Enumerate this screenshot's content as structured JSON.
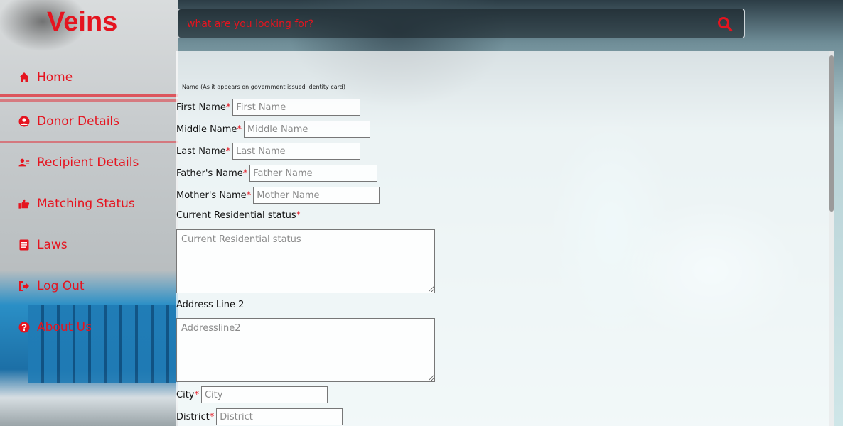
{
  "brand": "Veins",
  "nav": [
    {
      "label": "Home",
      "icon": "home-icon"
    },
    {
      "label": "Donor Details",
      "icon": "user-circle-icon"
    },
    {
      "label": "Recipient Details",
      "icon": "users-icon"
    },
    {
      "label": "Matching Status",
      "icon": "thumbs-up-icon"
    },
    {
      "label": "Laws",
      "icon": "document-icon"
    },
    {
      "label": "Log Out",
      "icon": "logout-icon"
    },
    {
      "label": "About Us",
      "icon": "question-icon"
    }
  ],
  "search": {
    "placeholder": "what are you looking for?"
  },
  "form": {
    "name_hint": "Name (As it appears on government issued identity card)",
    "first_name": {
      "label": "First Name",
      "required": "*",
      "placeholder": "First Name"
    },
    "middle_name": {
      "label": "Middle Name",
      "required": "*",
      "placeholder": "Middle Name"
    },
    "last_name": {
      "label": "Last Name",
      "required": "*",
      "placeholder": "Last Name"
    },
    "father_name": {
      "label": "Father's Name",
      "required": "*",
      "placeholder": "Father Name"
    },
    "mother_name": {
      "label": "Mother's Name",
      "required": "*",
      "placeholder": "Mother Name"
    },
    "residential": {
      "label": "Current Residential status",
      "required": "*",
      "placeholder": "Current Residential status"
    },
    "address2": {
      "label": "Address Line 2",
      "placeholder": "Addressline2"
    },
    "city": {
      "label": "City",
      "required": "*",
      "placeholder": "City"
    },
    "district": {
      "label": "District",
      "required": "*",
      "placeholder": "District"
    }
  },
  "colors": {
    "accent": "#e5141f"
  }
}
